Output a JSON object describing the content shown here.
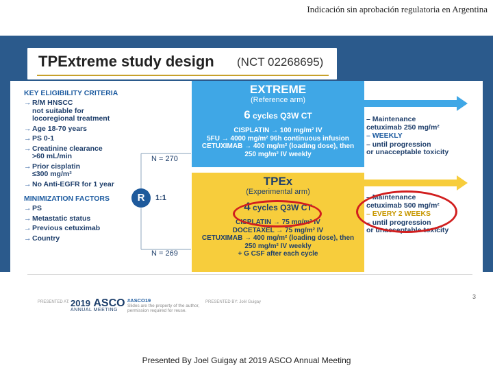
{
  "header_note": "Indicación sin aprobación regulatoria en Argentina",
  "slide": {
    "title": "TPExtreme study design",
    "title_nct": "(NCT 02268695)",
    "eligibility_heading": "KEY ELIGIBILITY CRITERIA",
    "eligibility": [
      "R/M HNSCC\nnot suitable for\nlocoregional treatment",
      "Age 18-70 years",
      "PS 0-1",
      "Creatinine clearance\n>60 mL/min",
      "Prior cisplatin\n≤300 mg/m²",
      "No Anti-EGFR for 1 year"
    ],
    "minimization_heading": "MINIMIZATION FACTORS",
    "minimization": [
      "PS",
      "Metastatic status",
      "Previous cetuximab",
      "Country"
    ],
    "randomization": {
      "label": "R",
      "ratio": "1:1",
      "n_top": "N = 270",
      "n_bottom": "N = 269"
    },
    "extreme": {
      "title": "EXTREME",
      "subtitle": "(Reference arm)",
      "cycles_num": "6",
      "cycles_text": "cycles Q3W CT",
      "regimen": "CISPLATIN → 100 mg/m² IV\n5FU → 4000 mg/m² 96h continuous infusion\nCETUXIMAB → 400 mg/m² (loading dose), then\n250 mg/m² IV weekly",
      "maintenance": [
        "– Maintenance\ncetuximab 250 mg/m²",
        "– WEEKLY",
        "– until progression\nor unacceptable toxicity"
      ]
    },
    "tpex": {
      "title": "TPEx",
      "subtitle": "(Experimental arm)",
      "cycles_num": "4",
      "cycles_text": "cycles Q3W CT",
      "regimen": "CISPLATIN → 75 mg/m² IV\nDOCETAXEL → 75 mg/m² IV\nCETUXIMAB → 400 mg/m² (loading dose), then\n250 mg/m² IV weekly\n+ G CSF after each cycle",
      "maintenance": [
        "– Maintenance\ncetuximab 500 mg/m²",
        "– EVERY 2 WEEKS",
        "– until progression\nor unacceptable toxicity"
      ]
    },
    "colors": {
      "slide_bg": "#2b5a8c",
      "extreme_box": "#3fa7e6",
      "tpex_box": "#f7cd3c",
      "highlight": "#d11e1e",
      "accent_text": "#f7cd3c"
    }
  },
  "footer": {
    "presented_at": "PRESENTED AT:",
    "asco_year": "2019",
    "asco_name": "ASCO",
    "asco_meeting": "ANNUAL MEETING",
    "hashtag": "#ASCO19",
    "hashtag_note": "Slides are the property of the author,\npermission required for reuse.",
    "presented_by": "PRESENTED BY: Joël Guigay",
    "page_number": "3"
  },
  "caption": "Presented By Joel Guigay at 2019 ASCO Annual Meeting"
}
